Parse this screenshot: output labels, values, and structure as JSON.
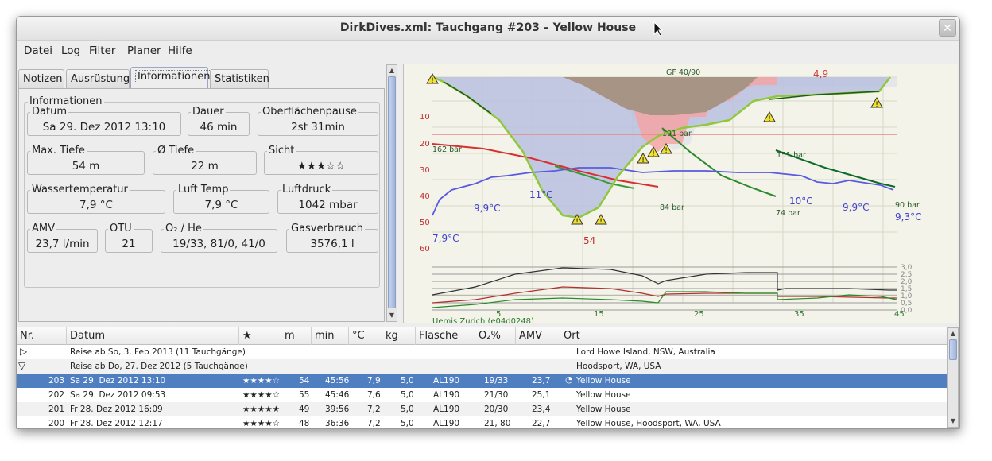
{
  "window": {
    "title": "DirkDives.xml: Tauchgang #203 – Yellow House"
  },
  "menu": [
    "Datei",
    "Log",
    "Filter",
    "Planer",
    "Hilfe"
  ],
  "tabs": [
    "Notizen",
    "Ausrüstung",
    "Informationen",
    "Statistiken"
  ],
  "info": {
    "group_title": "Informationen",
    "datum": {
      "label": "Datum",
      "value": "Sa 29. Dez 2012 13:10"
    },
    "dauer": {
      "label": "Dauer",
      "value": "46 min"
    },
    "pause": {
      "label": "Oberflächenpause",
      "value": "2st 31min"
    },
    "max_tiefe": {
      "label": "Max. Tiefe",
      "value": "54 m"
    },
    "avg_tiefe": {
      "label": "Ø Tiefe",
      "value": "22 m"
    },
    "sicht": {
      "label": "Sicht",
      "value": "★★★☆☆"
    },
    "wassertemp": {
      "label": "Wassertemperatur",
      "value": "7,9 °C"
    },
    "lufttemp": {
      "label": "Luft Temp",
      "value": "7,9 °C"
    },
    "luftdruck": {
      "label": "Luftdruck",
      "value": "1042 mbar"
    },
    "amv": {
      "label": "AMV",
      "value": "23,7 l/min"
    },
    "otu": {
      "label": "OTU",
      "value": "21"
    },
    "gas": {
      "label": "O₂ / He",
      "value": "19/33, 81/0, 41/0"
    },
    "gasverbrauch": {
      "label": "Gasverbrauch",
      "value": "3576,1 l"
    }
  },
  "profile": {
    "gf": "GF 40/90",
    "computer": "Uemis Zurich (e04d0248)",
    "depth_ticks": [
      "10",
      "20",
      "30",
      "40",
      "50",
      "60"
    ],
    "time_ticks": [
      "5",
      "15",
      "25",
      "35",
      "45"
    ],
    "pressure_ticks": [
      "3,0",
      "2,5",
      "2,0",
      "1,5",
      "1,0",
      "0,5",
      "0,0"
    ],
    "max_depth_label": "54",
    "ceiling_label": "4,9",
    "temp_labels": [
      "7,9°C",
      "9,9°C",
      "11°C",
      "10°C",
      "9,9°C",
      "9,3°C"
    ],
    "bar_labels": [
      "162 bar",
      "84 bar",
      "191 bar",
      "74 bar",
      "151 bar",
      "90 bar"
    ],
    "colors": {
      "ceiling": "#a89484",
      "deco": "#f4a4a4",
      "profile_fill": "#b8bfe0",
      "temp": "#5a5ae0",
      "pressure": "#2a8a2a",
      "profile_line": "#8fc83a",
      "warn": "#f0e030"
    }
  },
  "dive_list": {
    "columns": [
      "Nr.",
      "Datum",
      "★",
      "m",
      "min",
      "°C",
      "kg",
      "Flasche",
      "O₂%",
      "AMV",
      "Ort"
    ],
    "trips": [
      {
        "label": "Reise ab So, 3. Feb 2013 (11 Tauchgänge)",
        "location": "Lord Howe Island, NSW, Australia",
        "expanded": false
      },
      {
        "label": "Reise ab Do, 27. Dez 2012 (5 Tauchgänge)",
        "location": "Hoodsport, WA, USA",
        "expanded": true
      }
    ],
    "dives": [
      {
        "nr": "203",
        "datum": "Sa 29. Dez 2012 13:10",
        "stars": "★★★★☆",
        "m": "54",
        "min": "45:56",
        "c": "7,9",
        "kg": "5,0",
        "flasche": "AL190",
        "o2": "19/33",
        "amv": "23,7",
        "ort": "Yellow House",
        "selected": true
      },
      {
        "nr": "202",
        "datum": "Sa 29. Dez 2012 09:53",
        "stars": "★★★★☆",
        "m": "55",
        "min": "45:46",
        "c": "7,6",
        "kg": "5,0",
        "flasche": "AL190",
        "o2": "21/30",
        "amv": "25,1",
        "ort": "Yellow House",
        "selected": false
      },
      {
        "nr": "201",
        "datum": "Fr 28. Dez 2012 16:09",
        "stars": "★★★★★",
        "m": "49",
        "min": "39:56",
        "c": "7,2",
        "kg": "5,0",
        "flasche": "AL190",
        "o2": "20/30",
        "amv": "23,4",
        "ort": "Yellow House",
        "selected": false
      },
      {
        "nr": "200",
        "datum": "Fr 28. Dez 2012 12:17",
        "stars": "★★★★☆",
        "m": "48",
        "min": "36:36",
        "c": "7,2",
        "kg": "5,0",
        "flasche": "AL190",
        "o2": "21, 80",
        "amv": "22,7",
        "ort": "Yellow House, Hoodsport, WA, USA",
        "selected": false
      }
    ]
  }
}
